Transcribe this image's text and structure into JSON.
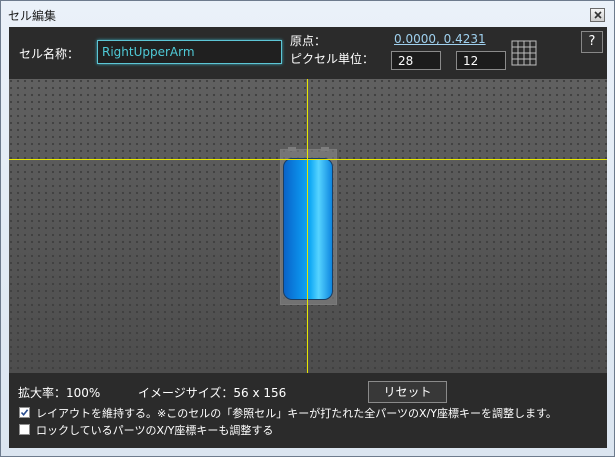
{
  "window": {
    "title": "セル編集",
    "close_icon": "close-icon"
  },
  "dialog": {
    "help_label": "?",
    "cell_name_label": "セル名称：",
    "cell_name_value": "RightUpperArm",
    "origin_label": "原点：",
    "origin_value": "0.0000, 0.4231",
    "pixel_unit_label": "ピクセル単位：",
    "pixel_unit_x": "28",
    "pixel_unit_y": "12",
    "grid_icon": "grid-icon"
  },
  "canvas": {
    "guide_color": "#e6e600",
    "arm_color": "#0b8ae6"
  },
  "footer": {
    "zoom": "拡大率：100%",
    "image_size": "イメージサイズ：56 x 156",
    "reset_label": "リセット",
    "option1_checked": true,
    "option1_label": "レイアウトを維持する。※このセルの「参照セル」キーが打たれた全パーツのX/Y座標キーを調整します。",
    "option2_checked": false,
    "option2_label": "ロックしているパーツのX/Y座標キーも調整する"
  }
}
